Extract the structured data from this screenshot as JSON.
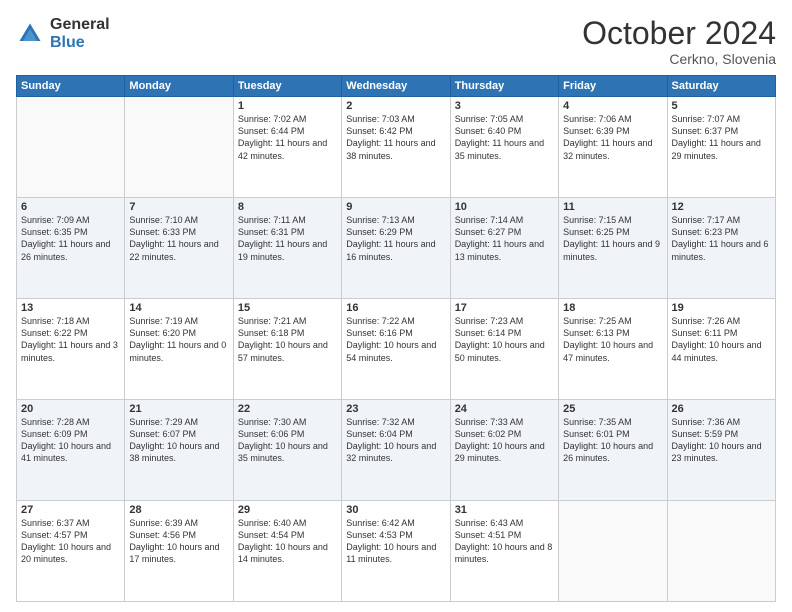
{
  "header": {
    "logo_general": "General",
    "logo_blue": "Blue",
    "month_title": "October 2024",
    "location": "Cerkno, Slovenia"
  },
  "weekdays": [
    "Sunday",
    "Monday",
    "Tuesday",
    "Wednesday",
    "Thursday",
    "Friday",
    "Saturday"
  ],
  "weeks": [
    [
      {
        "day": "",
        "sunrise": "",
        "sunset": "",
        "daylight": ""
      },
      {
        "day": "",
        "sunrise": "",
        "sunset": "",
        "daylight": ""
      },
      {
        "day": "1",
        "sunrise": "Sunrise: 7:02 AM",
        "sunset": "Sunset: 6:44 PM",
        "daylight": "Daylight: 11 hours and 42 minutes."
      },
      {
        "day": "2",
        "sunrise": "Sunrise: 7:03 AM",
        "sunset": "Sunset: 6:42 PM",
        "daylight": "Daylight: 11 hours and 38 minutes."
      },
      {
        "day": "3",
        "sunrise": "Sunrise: 7:05 AM",
        "sunset": "Sunset: 6:40 PM",
        "daylight": "Daylight: 11 hours and 35 minutes."
      },
      {
        "day": "4",
        "sunrise": "Sunrise: 7:06 AM",
        "sunset": "Sunset: 6:39 PM",
        "daylight": "Daylight: 11 hours and 32 minutes."
      },
      {
        "day": "5",
        "sunrise": "Sunrise: 7:07 AM",
        "sunset": "Sunset: 6:37 PM",
        "daylight": "Daylight: 11 hours and 29 minutes."
      }
    ],
    [
      {
        "day": "6",
        "sunrise": "Sunrise: 7:09 AM",
        "sunset": "Sunset: 6:35 PM",
        "daylight": "Daylight: 11 hours and 26 minutes."
      },
      {
        "day": "7",
        "sunrise": "Sunrise: 7:10 AM",
        "sunset": "Sunset: 6:33 PM",
        "daylight": "Daylight: 11 hours and 22 minutes."
      },
      {
        "day": "8",
        "sunrise": "Sunrise: 7:11 AM",
        "sunset": "Sunset: 6:31 PM",
        "daylight": "Daylight: 11 hours and 19 minutes."
      },
      {
        "day": "9",
        "sunrise": "Sunrise: 7:13 AM",
        "sunset": "Sunset: 6:29 PM",
        "daylight": "Daylight: 11 hours and 16 minutes."
      },
      {
        "day": "10",
        "sunrise": "Sunrise: 7:14 AM",
        "sunset": "Sunset: 6:27 PM",
        "daylight": "Daylight: 11 hours and 13 minutes."
      },
      {
        "day": "11",
        "sunrise": "Sunrise: 7:15 AM",
        "sunset": "Sunset: 6:25 PM",
        "daylight": "Daylight: 11 hours and 9 minutes."
      },
      {
        "day": "12",
        "sunrise": "Sunrise: 7:17 AM",
        "sunset": "Sunset: 6:23 PM",
        "daylight": "Daylight: 11 hours and 6 minutes."
      }
    ],
    [
      {
        "day": "13",
        "sunrise": "Sunrise: 7:18 AM",
        "sunset": "Sunset: 6:22 PM",
        "daylight": "Daylight: 11 hours and 3 minutes."
      },
      {
        "day": "14",
        "sunrise": "Sunrise: 7:19 AM",
        "sunset": "Sunset: 6:20 PM",
        "daylight": "Daylight: 11 hours and 0 minutes."
      },
      {
        "day": "15",
        "sunrise": "Sunrise: 7:21 AM",
        "sunset": "Sunset: 6:18 PM",
        "daylight": "Daylight: 10 hours and 57 minutes."
      },
      {
        "day": "16",
        "sunrise": "Sunrise: 7:22 AM",
        "sunset": "Sunset: 6:16 PM",
        "daylight": "Daylight: 10 hours and 54 minutes."
      },
      {
        "day": "17",
        "sunrise": "Sunrise: 7:23 AM",
        "sunset": "Sunset: 6:14 PM",
        "daylight": "Daylight: 10 hours and 50 minutes."
      },
      {
        "day": "18",
        "sunrise": "Sunrise: 7:25 AM",
        "sunset": "Sunset: 6:13 PM",
        "daylight": "Daylight: 10 hours and 47 minutes."
      },
      {
        "day": "19",
        "sunrise": "Sunrise: 7:26 AM",
        "sunset": "Sunset: 6:11 PM",
        "daylight": "Daylight: 10 hours and 44 minutes."
      }
    ],
    [
      {
        "day": "20",
        "sunrise": "Sunrise: 7:28 AM",
        "sunset": "Sunset: 6:09 PM",
        "daylight": "Daylight: 10 hours and 41 minutes."
      },
      {
        "day": "21",
        "sunrise": "Sunrise: 7:29 AM",
        "sunset": "Sunset: 6:07 PM",
        "daylight": "Daylight: 10 hours and 38 minutes."
      },
      {
        "day": "22",
        "sunrise": "Sunrise: 7:30 AM",
        "sunset": "Sunset: 6:06 PM",
        "daylight": "Daylight: 10 hours and 35 minutes."
      },
      {
        "day": "23",
        "sunrise": "Sunrise: 7:32 AM",
        "sunset": "Sunset: 6:04 PM",
        "daylight": "Daylight: 10 hours and 32 minutes."
      },
      {
        "day": "24",
        "sunrise": "Sunrise: 7:33 AM",
        "sunset": "Sunset: 6:02 PM",
        "daylight": "Daylight: 10 hours and 29 minutes."
      },
      {
        "day": "25",
        "sunrise": "Sunrise: 7:35 AM",
        "sunset": "Sunset: 6:01 PM",
        "daylight": "Daylight: 10 hours and 26 minutes."
      },
      {
        "day": "26",
        "sunrise": "Sunrise: 7:36 AM",
        "sunset": "Sunset: 5:59 PM",
        "daylight": "Daylight: 10 hours and 23 minutes."
      }
    ],
    [
      {
        "day": "27",
        "sunrise": "Sunrise: 6:37 AM",
        "sunset": "Sunset: 4:57 PM",
        "daylight": "Daylight: 10 hours and 20 minutes."
      },
      {
        "day": "28",
        "sunrise": "Sunrise: 6:39 AM",
        "sunset": "Sunset: 4:56 PM",
        "daylight": "Daylight: 10 hours and 17 minutes."
      },
      {
        "day": "29",
        "sunrise": "Sunrise: 6:40 AM",
        "sunset": "Sunset: 4:54 PM",
        "daylight": "Daylight: 10 hours and 14 minutes."
      },
      {
        "day": "30",
        "sunrise": "Sunrise: 6:42 AM",
        "sunset": "Sunset: 4:53 PM",
        "daylight": "Daylight: 10 hours and 11 minutes."
      },
      {
        "day": "31",
        "sunrise": "Sunrise: 6:43 AM",
        "sunset": "Sunset: 4:51 PM",
        "daylight": "Daylight: 10 hours and 8 minutes."
      },
      {
        "day": "",
        "sunrise": "",
        "sunset": "",
        "daylight": ""
      },
      {
        "day": "",
        "sunrise": "",
        "sunset": "",
        "daylight": ""
      }
    ]
  ]
}
